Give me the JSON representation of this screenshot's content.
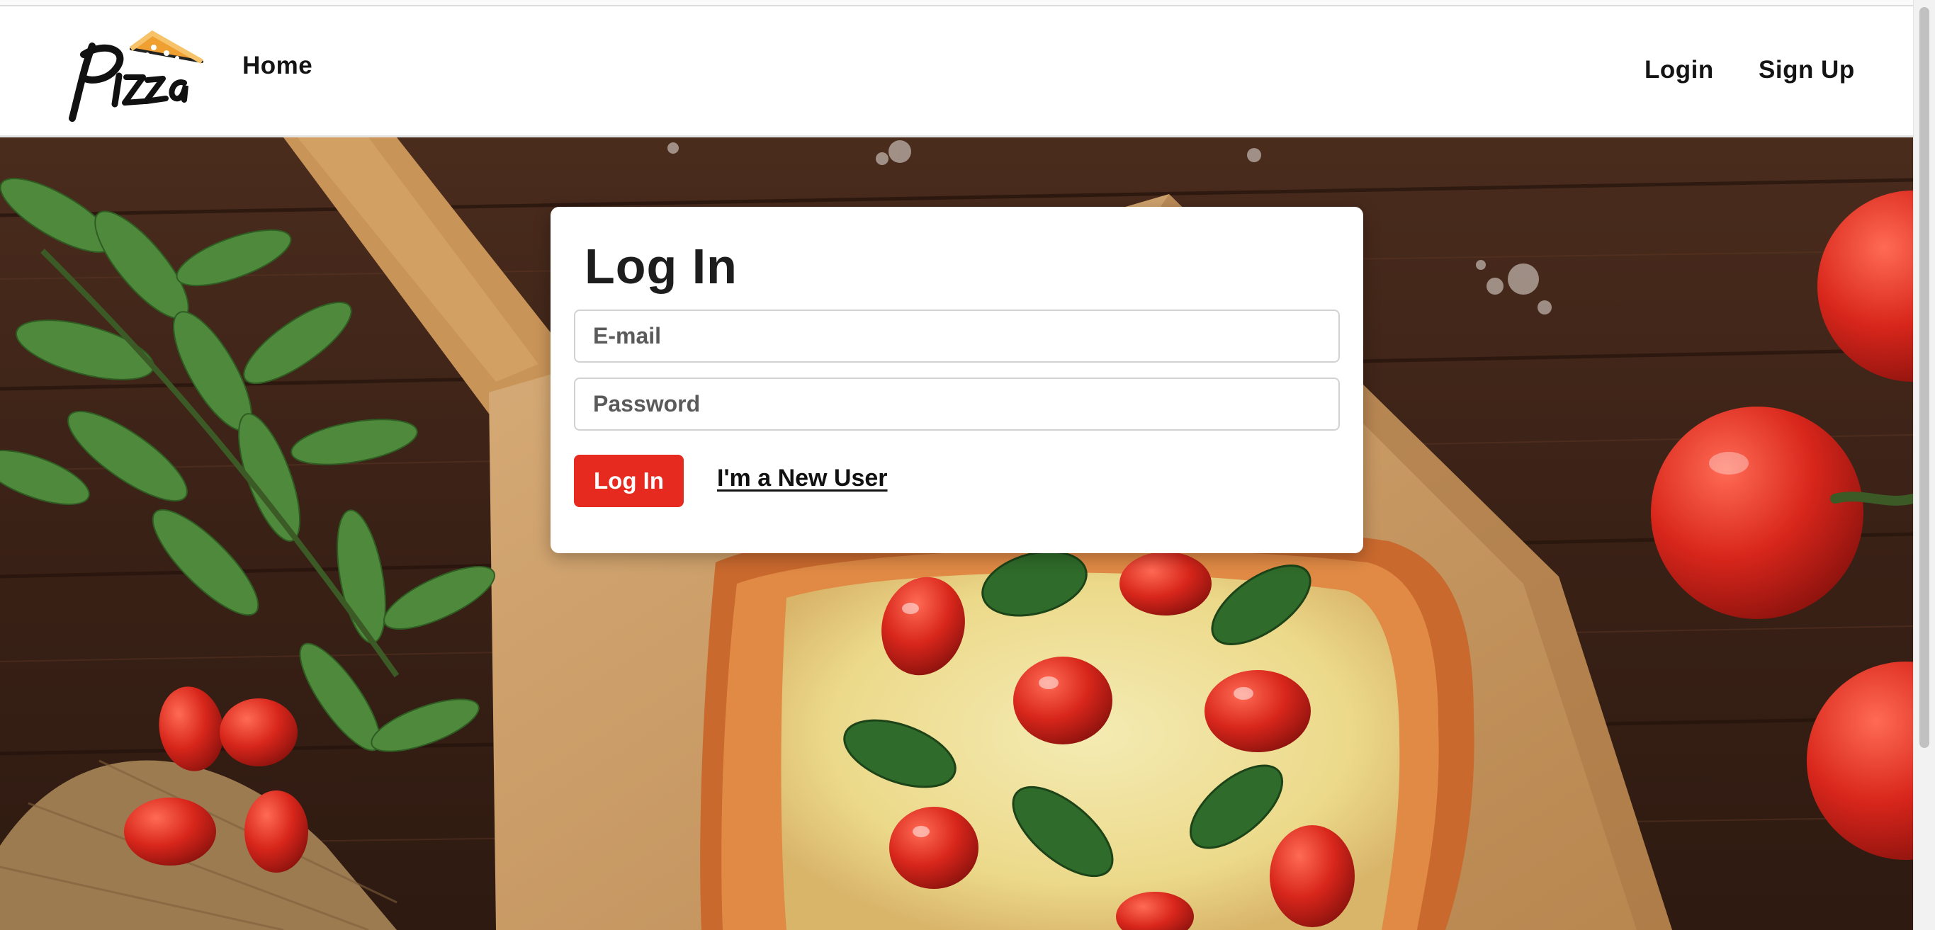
{
  "nav": {
    "logo_text": "Pizza",
    "home_label": "Home",
    "login_label": "Login",
    "signup_label": "Sign Up"
  },
  "login_form": {
    "title": "Log In",
    "email_placeholder": "E-mail",
    "email_value": "",
    "password_placeholder": "Password",
    "password_value": "",
    "submit_label": "Log In",
    "new_user_label": "I'm a New User"
  },
  "colors": {
    "accent": "#e62a1f",
    "logo_slice": "#f0a030",
    "background_wood": "#3d2418"
  },
  "icons": {
    "logo": "pizza-slice-logo"
  }
}
